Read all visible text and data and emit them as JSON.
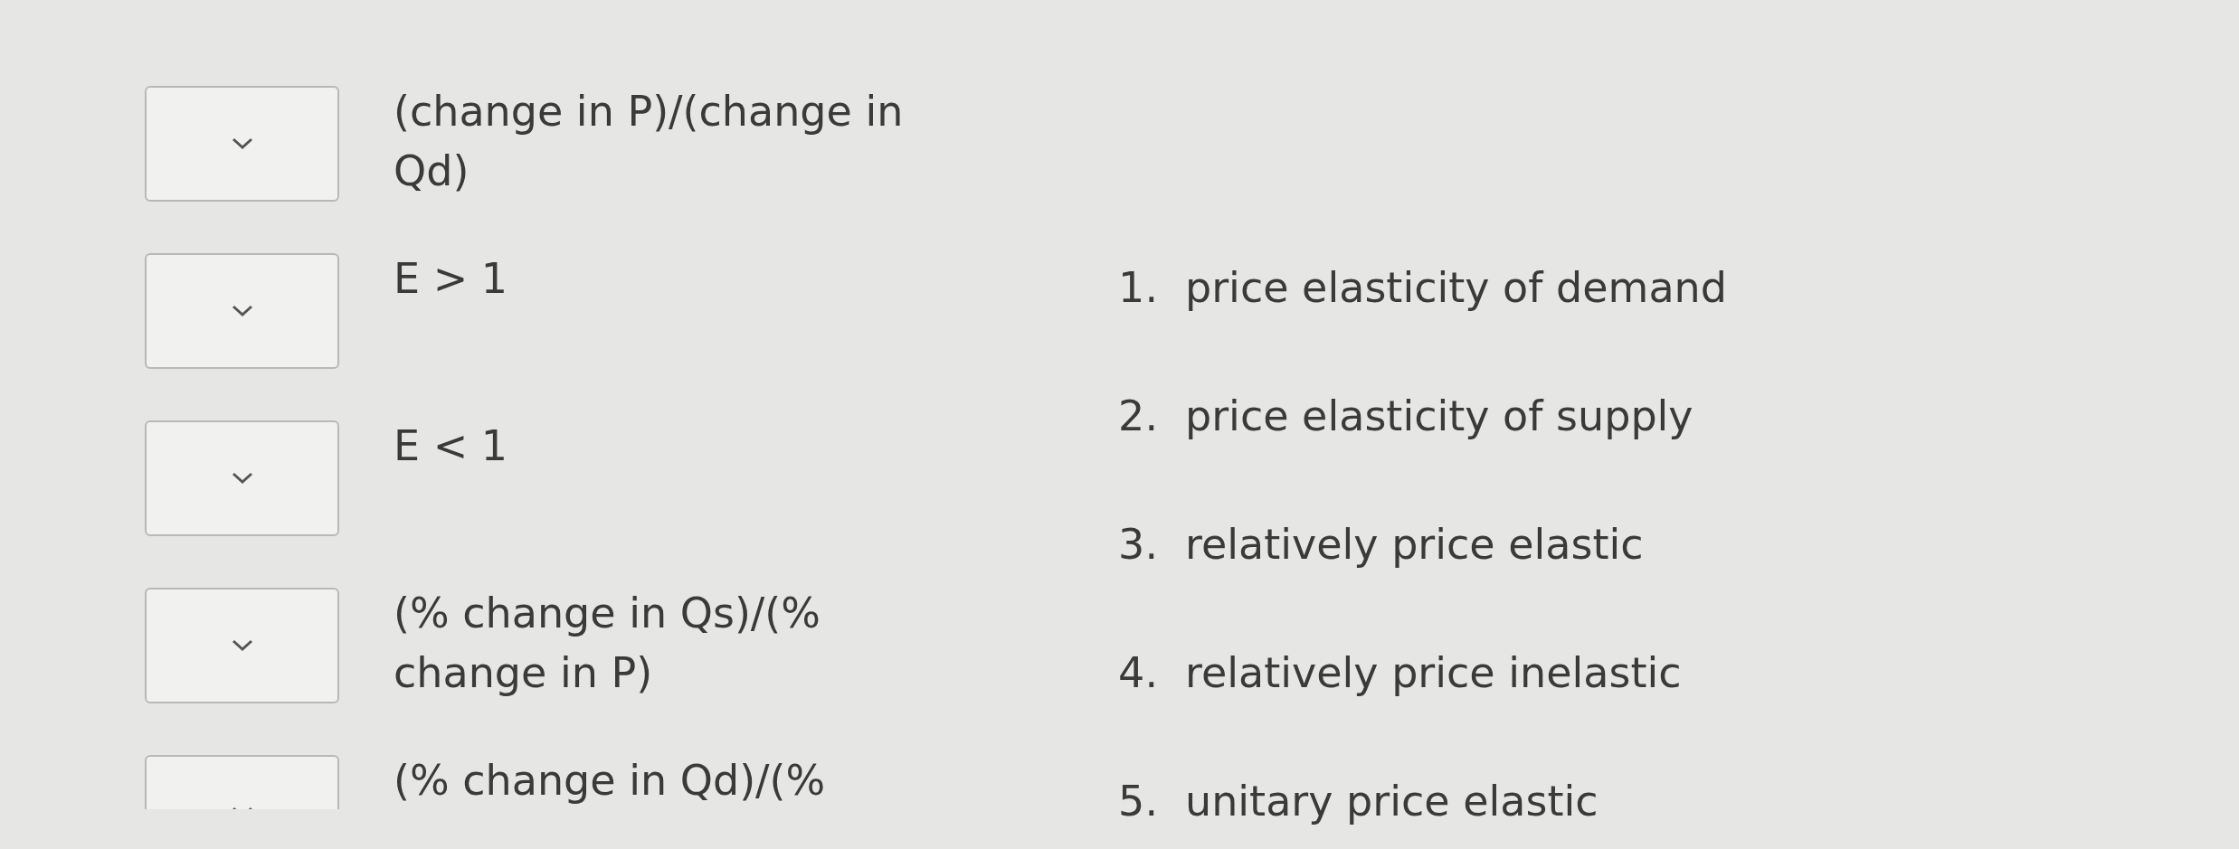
{
  "matching_items": [
    {
      "text": "(change in P)/(change in Qd)"
    },
    {
      "text": "E > 1"
    },
    {
      "text": "E < 1"
    },
    {
      "text": "(% change in Qs)/(% change in P)"
    },
    {
      "text": "(% change in Qd)/(%"
    }
  ],
  "answer_options": [
    {
      "number": "1.",
      "text": "price elasticity of demand"
    },
    {
      "number": "2.",
      "text": "price elasticity of supply"
    },
    {
      "number": "3.",
      "text": "relatively price elastic"
    },
    {
      "number": "4.",
      "text": "relatively price inelastic"
    },
    {
      "number": "5.",
      "text": "unitary price elastic"
    }
  ]
}
